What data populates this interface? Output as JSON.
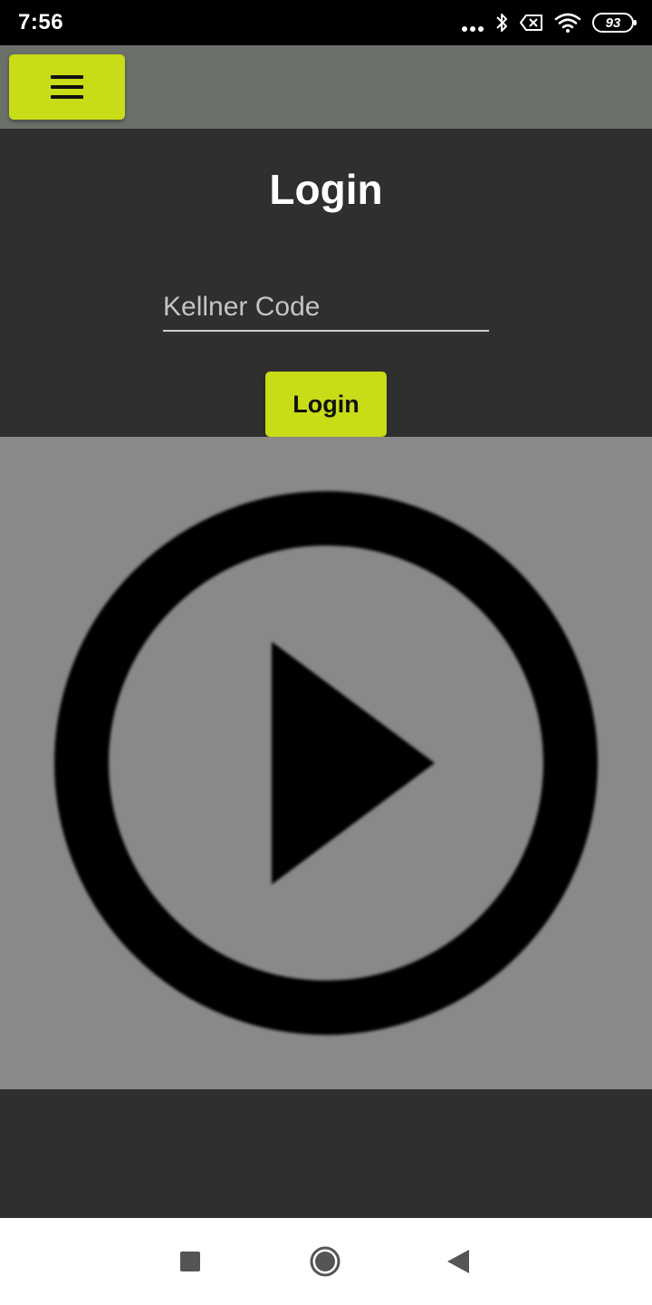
{
  "status_bar": {
    "time": "7:56",
    "battery_level": "93",
    "icons": [
      "more-dots-icon",
      "bluetooth-icon",
      "no-sim-icon",
      "wifi-icon",
      "battery-icon"
    ]
  },
  "app_bar": {
    "menu_icon": "hamburger-icon"
  },
  "login": {
    "title": "Login",
    "code_placeholder": "Kellner Code",
    "code_value": "",
    "button_label": "Login"
  },
  "video": {
    "icon": "play-circle-icon"
  },
  "navigation": {
    "icons": [
      "recents-square-icon",
      "home-circle-icon",
      "back-triangle-icon"
    ]
  },
  "colors": {
    "accent": "#c8dc17",
    "app_bar": "#6b706a",
    "background": "#2f2f2f",
    "video_background": "#898989"
  }
}
